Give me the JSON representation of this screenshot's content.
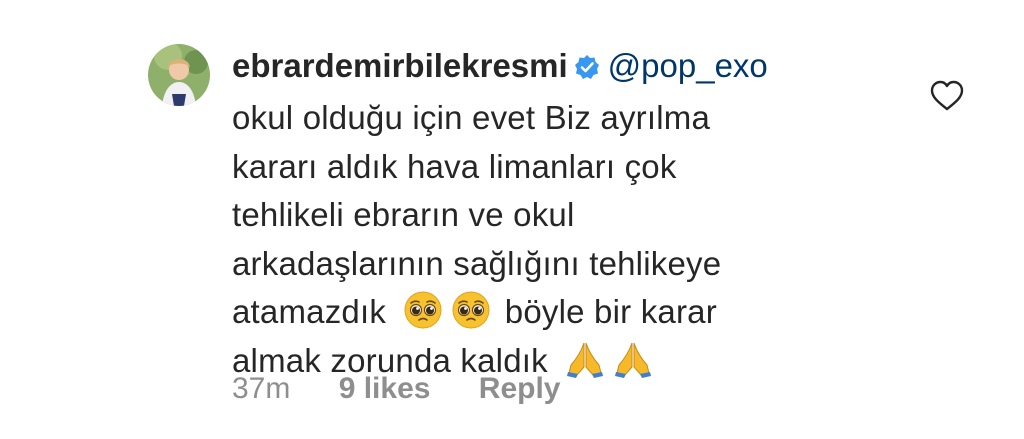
{
  "comment": {
    "username": "ebrardemirbilekresmi",
    "verified_icon": "verified-badge-icon",
    "mention": "@pop_exo",
    "lines": [
      "okul olduğu için evet Biz ayrılma",
      "kararı aldık hava limanları çok",
      "tehlikeli ebrarın ve okul",
      "arkadaşlarının sağlığını tehlikeye"
    ],
    "line5_before": "atamazdık",
    "line5_after": "böyle bir karar",
    "line6": "almak zorunda kaldık",
    "emojis": {
      "pleading": "pleading-face-icon",
      "folded_hands": "folded-hands-icon"
    },
    "time": "37m",
    "likes": "9 likes",
    "reply": "Reply",
    "like_icon": "heart-outline-icon"
  },
  "colors": {
    "text": "#262626",
    "meta": "#8e8e8e",
    "mention": "#00376b",
    "verified": "#3897f0"
  }
}
